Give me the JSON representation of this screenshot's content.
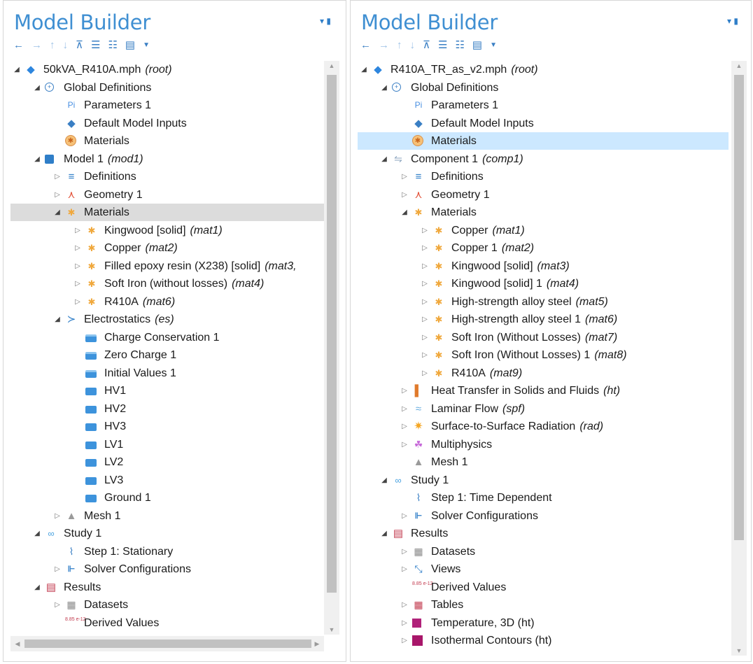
{
  "left_panel": {
    "title": "Model Builder",
    "toolbar_icons": [
      "arrow-left",
      "arrow-right",
      "arrow-up",
      "arrow-down",
      "show-icon",
      "collapse-icon",
      "expand-icon",
      "menu-icon",
      "chevron-down"
    ],
    "tree": [
      {
        "label": "50kVA_R410A.mph",
        "tag": "(root)",
        "icon": "root-icon",
        "level": 0,
        "toggle": "open"
      },
      {
        "label": "Global Definitions",
        "tag": "",
        "icon": "globe-icon",
        "level": 1,
        "toggle": "open"
      },
      {
        "label": "Parameters 1",
        "tag": "",
        "icon": "parameters-icon",
        "level": 2,
        "toggle": ""
      },
      {
        "label": "Default Model Inputs",
        "tag": "",
        "icon": "model-inputs-icon",
        "level": 2,
        "toggle": ""
      },
      {
        "label": "Materials",
        "tag": "",
        "icon": "materials-icon",
        "level": 2,
        "toggle": ""
      },
      {
        "label": "Model 1",
        "tag": "(mod1)",
        "icon": "model-icon",
        "level": 1,
        "toggle": "open"
      },
      {
        "label": "Definitions",
        "tag": "",
        "icon": "definitions-icon",
        "level": 2,
        "toggle": "closed"
      },
      {
        "label": "Geometry 1",
        "tag": "",
        "icon": "geometry-icon",
        "level": 2,
        "toggle": "closed"
      },
      {
        "label": "Materials",
        "tag": "",
        "icon": "materials-small-icon",
        "level": 2,
        "toggle": "open",
        "selected": "gray"
      },
      {
        "label": "Kingwood [solid]",
        "tag": "(mat1)",
        "icon": "material-icon",
        "level": 3,
        "toggle": "closed"
      },
      {
        "label": "Copper",
        "tag": "(mat2)",
        "icon": "material-icon",
        "level": 3,
        "toggle": "closed"
      },
      {
        "label": "Filled epoxy resin (X238) [solid]",
        "tag": "(mat3,",
        "icon": "material-icon",
        "level": 3,
        "toggle": "closed"
      },
      {
        "label": "Soft Iron (without losses)",
        "tag": "(mat4)",
        "icon": "material-icon",
        "level": 3,
        "toggle": "closed"
      },
      {
        "label": "R410A",
        "tag": "(mat6)",
        "icon": "material-icon",
        "level": 3,
        "toggle": "closed"
      },
      {
        "label": "Electrostatics",
        "tag": "(es)",
        "icon": "electrostatics-icon",
        "level": 2,
        "toggle": "open"
      },
      {
        "label": "Charge Conservation 1",
        "tag": "",
        "icon": "feature-icon",
        "level": 3,
        "toggle": ""
      },
      {
        "label": "Zero Charge 1",
        "tag": "",
        "icon": "feature-icon",
        "level": 3,
        "toggle": ""
      },
      {
        "label": "Initial Values 1",
        "tag": "",
        "icon": "feature-icon",
        "level": 3,
        "toggle": ""
      },
      {
        "label": "HV1",
        "tag": "",
        "icon": "boundary-icon",
        "level": 3,
        "toggle": ""
      },
      {
        "label": "HV2",
        "tag": "",
        "icon": "boundary-icon",
        "level": 3,
        "toggle": ""
      },
      {
        "label": "HV3",
        "tag": "",
        "icon": "boundary-icon",
        "level": 3,
        "toggle": ""
      },
      {
        "label": "LV1",
        "tag": "",
        "icon": "boundary-icon",
        "level": 3,
        "toggle": ""
      },
      {
        "label": "LV2",
        "tag": "",
        "icon": "boundary-icon",
        "level": 3,
        "toggle": ""
      },
      {
        "label": "LV3",
        "tag": "",
        "icon": "boundary-icon",
        "level": 3,
        "toggle": ""
      },
      {
        "label": "Ground 1",
        "tag": "",
        "icon": "boundary-icon",
        "level": 3,
        "toggle": ""
      },
      {
        "label": "Mesh 1",
        "tag": "",
        "icon": "mesh-icon",
        "level": 2,
        "toggle": "closed"
      },
      {
        "label": "Study 1",
        "tag": "",
        "icon": "study-icon",
        "level": 1,
        "toggle": "open"
      },
      {
        "label": "Step 1: Stationary",
        "tag": "",
        "icon": "step-icon",
        "level": 2,
        "toggle": ""
      },
      {
        "label": "Solver Configurations",
        "tag": "",
        "icon": "solver-icon",
        "level": 2,
        "toggle": "closed"
      },
      {
        "label": "Results",
        "tag": "",
        "icon": "results-icon",
        "level": 1,
        "toggle": "open"
      },
      {
        "label": "Datasets",
        "tag": "",
        "icon": "datasets-icon",
        "level": 2,
        "toggle": "closed"
      },
      {
        "label": "Derived Values",
        "tag": "",
        "icon": "derived-values-icon",
        "level": 2,
        "toggle": ""
      }
    ]
  },
  "right_panel": {
    "title": "Model Builder",
    "toolbar_icons": [
      "arrow-left",
      "arrow-right",
      "arrow-up",
      "arrow-down",
      "show-icon",
      "collapse-icon",
      "expand-icon",
      "menu-icon",
      "chevron-down"
    ],
    "tree": [
      {
        "label": "R410A_TR_as_v2.mph",
        "tag": "(root)",
        "icon": "root-icon",
        "level": 0,
        "toggle": "open"
      },
      {
        "label": "Global Definitions",
        "tag": "",
        "icon": "globe-icon",
        "level": 1,
        "toggle": "open"
      },
      {
        "label": "Parameters 1",
        "tag": "",
        "icon": "parameters-icon",
        "level": 2,
        "toggle": ""
      },
      {
        "label": "Default Model Inputs",
        "tag": "",
        "icon": "model-inputs-icon",
        "level": 2,
        "toggle": ""
      },
      {
        "label": "Materials",
        "tag": "",
        "icon": "materials-icon",
        "level": 2,
        "toggle": "",
        "selected": "blue"
      },
      {
        "label": "Component 1",
        "tag": "(comp1)",
        "icon": "component-icon",
        "level": 1,
        "toggle": "open"
      },
      {
        "label": "Definitions",
        "tag": "",
        "icon": "definitions-icon",
        "level": 2,
        "toggle": "closed"
      },
      {
        "label": "Geometry 1",
        "tag": "",
        "icon": "geometry-icon",
        "level": 2,
        "toggle": "closed"
      },
      {
        "label": "Materials",
        "tag": "",
        "icon": "materials-small-icon",
        "level": 2,
        "toggle": "open"
      },
      {
        "label": "Copper",
        "tag": "(mat1)",
        "icon": "material-icon",
        "level": 3,
        "toggle": "closed"
      },
      {
        "label": "Copper 1",
        "tag": "(mat2)",
        "icon": "material-icon",
        "level": 3,
        "toggle": "closed"
      },
      {
        "label": "Kingwood [solid]",
        "tag": "(mat3)",
        "icon": "material-icon",
        "level": 3,
        "toggle": "closed"
      },
      {
        "label": "Kingwood [solid] 1",
        "tag": "(mat4)",
        "icon": "material-icon",
        "level": 3,
        "toggle": "closed"
      },
      {
        "label": "High-strength alloy steel",
        "tag": "(mat5)",
        "icon": "material-icon",
        "level": 3,
        "toggle": "closed"
      },
      {
        "label": "High-strength alloy steel 1",
        "tag": "(mat6)",
        "icon": "material-icon",
        "level": 3,
        "toggle": "closed"
      },
      {
        "label": "Soft Iron (Without Losses)",
        "tag": "(mat7)",
        "icon": "material-icon",
        "level": 3,
        "toggle": "closed"
      },
      {
        "label": "Soft Iron (Without Losses) 1",
        "tag": "(mat8)",
        "icon": "material-icon",
        "level": 3,
        "toggle": "closed"
      },
      {
        "label": "R410A",
        "tag": "(mat9)",
        "icon": "material-icon",
        "level": 3,
        "toggle": "closed"
      },
      {
        "label": "Heat Transfer in Solids and Fluids",
        "tag": "(ht)",
        "icon": "heat-transfer-icon",
        "level": 2,
        "toggle": "closed"
      },
      {
        "label": "Laminar Flow",
        "tag": "(spf)",
        "icon": "laminar-flow-icon",
        "level": 2,
        "toggle": "closed"
      },
      {
        "label": "Surface-to-Surface Radiation",
        "tag": "(rad)",
        "icon": "radiation-icon",
        "level": 2,
        "toggle": "closed"
      },
      {
        "label": "Multiphysics",
        "tag": "",
        "icon": "multiphysics-icon",
        "level": 2,
        "toggle": "closed"
      },
      {
        "label": "Mesh 1",
        "tag": "",
        "icon": "mesh-icon",
        "level": 2,
        "toggle": ""
      },
      {
        "label": "Study 1",
        "tag": "",
        "icon": "study-icon",
        "level": 1,
        "toggle": "open"
      },
      {
        "label": "Step 1: Time Dependent",
        "tag": "",
        "icon": "step-icon",
        "level": 2,
        "toggle": ""
      },
      {
        "label": "Solver Configurations",
        "tag": "",
        "icon": "solver-icon",
        "level": 2,
        "toggle": "closed"
      },
      {
        "label": "Results",
        "tag": "",
        "icon": "results-icon",
        "level": 1,
        "toggle": "open"
      },
      {
        "label": "Datasets",
        "tag": "",
        "icon": "datasets-icon",
        "level": 2,
        "toggle": "closed"
      },
      {
        "label": "Views",
        "tag": "",
        "icon": "views-icon",
        "level": 2,
        "toggle": "closed"
      },
      {
        "label": "Derived Values",
        "tag": "",
        "icon": "derived-values-icon",
        "level": 2,
        "toggle": ""
      },
      {
        "label": "Tables",
        "tag": "",
        "icon": "tables-icon",
        "level": 2,
        "toggle": "closed"
      },
      {
        "label": "Temperature, 3D (ht)",
        "tag": "",
        "icon": "plot-group-3d-icon",
        "level": 2,
        "toggle": "closed"
      },
      {
        "label": "Isothermal Contours (ht)",
        "tag": "",
        "icon": "plot-group-icon",
        "level": 2,
        "toggle": "closed"
      }
    ]
  },
  "icon_glyphs": {
    "root-icon": "◆",
    "globe-icon": "+",
    "parameters-icon": "Pi",
    "model-inputs-icon": "◆",
    "materials-icon": "✱",
    "materials-small-icon": "✱",
    "material-icon": "✱",
    "model-icon": "",
    "component-icon": "⇋",
    "definitions-icon": "≡",
    "geometry-icon": "⋏",
    "electrostatics-icon": "≻",
    "feature-icon": "",
    "boundary-icon": "",
    "mesh-icon": "▲",
    "study-icon": "∞",
    "step-icon": "⌇",
    "solver-icon": "⊩",
    "results-icon": "▤",
    "datasets-icon": "▦",
    "derived-values-icon": "8.85 e-12",
    "heat-transfer-icon": "▌",
    "laminar-flow-icon": "≈",
    "radiation-icon": "✷",
    "multiphysics-icon": "☘",
    "views-icon": "⤡",
    "tables-icon": "▦",
    "plot-group-3d-icon": "",
    "plot-group-icon": ""
  }
}
